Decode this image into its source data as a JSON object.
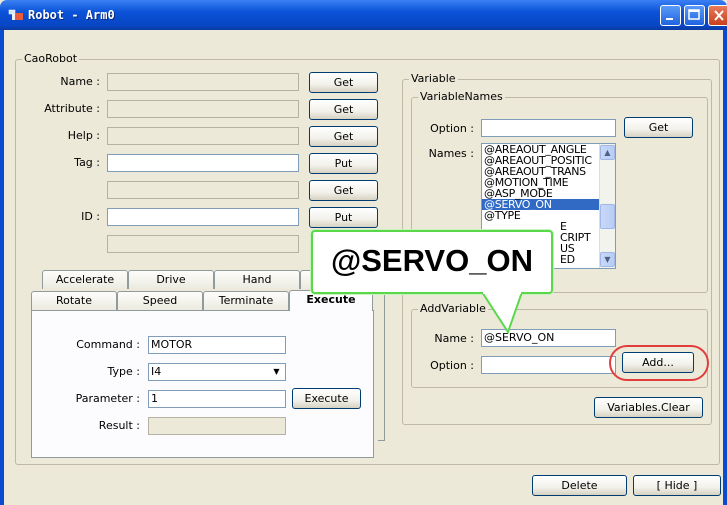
{
  "window": {
    "title": "Robot - Arm0"
  },
  "cao_robot": {
    "legend": "CaoRobot",
    "name_label": "Name :",
    "attribute_label": "Attribute :",
    "help_label": "Help :",
    "tag_label": "Tag :",
    "id_label": "ID :",
    "get": "Get",
    "put": "Put"
  },
  "tabs": {
    "row_back": [
      "Accelerate",
      "Drive",
      "Hand"
    ],
    "row_front": [
      "Rotate",
      "Speed",
      "Terminate",
      "Execute"
    ],
    "active": "Execute"
  },
  "execute_panel": {
    "command_label": "Command :",
    "command_value": "MOTOR",
    "type_label": "Type :",
    "type_value": "I4",
    "parameter_label": "Parameter :",
    "parameter_value": "1",
    "execute_button": "Execute",
    "result_label": "Result :"
  },
  "variable": {
    "legend": "Variable",
    "names_group": {
      "legend": "VariableNames",
      "option_label": "Option :",
      "get_button": "Get",
      "names_label": "Names :",
      "items": [
        "@AREAOUT_ANGLE",
        "@AREAOUT_POSITIC",
        "@AREAOUT_TRANS",
        "@MOTION_TIME",
        "@ASP_MODE",
        "@SERVO_ON",
        "@TYPE",
        "E",
        "CRIPT",
        "US",
        "ED"
      ],
      "selected": "@SERVO_ON"
    },
    "add_group": {
      "legend": "AddVariable",
      "name_label": "Name :",
      "name_value": "@SERVO_ON",
      "option_label": "Option :",
      "add_button": "Add..."
    },
    "clear_button": "Variables.Clear"
  },
  "footer": {
    "delete": "Delete",
    "hide": "[ Hide ]"
  },
  "callout": {
    "text": "@SERVO_ON"
  },
  "colors": {
    "titlebar": "#0a52d8",
    "selection": "#316ac5",
    "callout_border": "#59d94a",
    "highlight_ring": "#e23c3c"
  }
}
